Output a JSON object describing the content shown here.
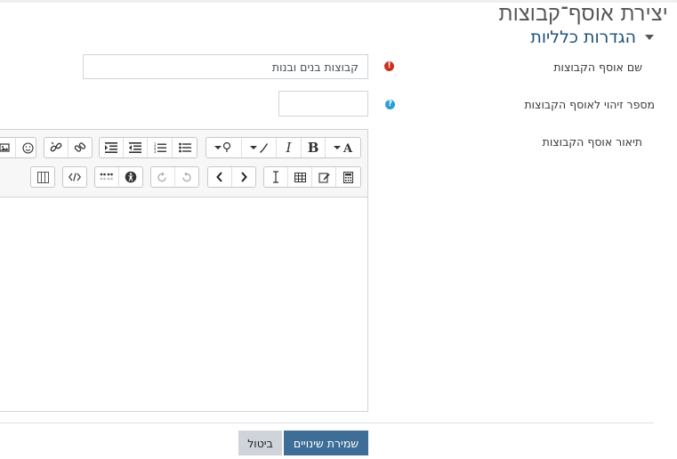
{
  "page": {
    "title": "יצירת אוסף־קבוצות"
  },
  "section": {
    "header": "הגדרות כלליות"
  },
  "form": {
    "name": {
      "label": "שם אוסף הקבוצות",
      "value": "קבוצות בנים ובנות",
      "required_icon": "exclamation-circle-icon"
    },
    "idnumber": {
      "label": "מספר זיהוי לאוסף הקבוצות",
      "value": "",
      "help_icon": "question-circle-icon"
    },
    "description": {
      "label": "תיאור אוסף הקבוצות",
      "content": ""
    }
  },
  "editor": {
    "toolbar_row1": [
      "font-style-menu",
      "bold",
      "italic",
      "font-color-menu",
      "highlight-color-menu",
      "unordered-list",
      "ordered-list",
      "outdent",
      "indent",
      "link",
      "unlink",
      "emoji",
      "image"
    ],
    "toolbar_row2": [
      "calculator",
      "edit",
      "table",
      "clear-format",
      "rtl",
      "ltr",
      "undo",
      "redo",
      "accessibility",
      "braille",
      "html",
      "columns"
    ]
  },
  "buttons": {
    "save": "שמירת שינויים",
    "cancel": "ביטול"
  },
  "colors": {
    "primary": "#3e6e98",
    "section_header": "#1f4f7a",
    "required": "#ca3120",
    "help": "#2a9fd6"
  }
}
